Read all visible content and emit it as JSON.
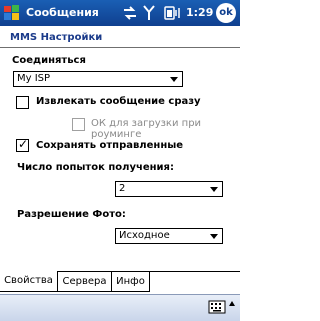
{
  "titlebar": {
    "title": "Сообщения",
    "time": "1:29",
    "ok_label": "ok",
    "icons": [
      "windows-start-icon",
      "connectivity-icon",
      "signal-icon",
      "battery-icon"
    ]
  },
  "header": {
    "title": "MMS Настройки"
  },
  "form": {
    "connect_label": "Соединяться",
    "connect_value": "My ISP",
    "retrieve_immediately": {
      "label": "Извлекать сообщение сразу",
      "checked": false
    },
    "ok_roaming": {
      "label": "ОК для загрузки при роуминге",
      "checked": false,
      "disabled": true
    },
    "save_sent": {
      "label": "Сохранять отправленные",
      "checked": true
    },
    "retries_label": "Число попыток получения:",
    "retries_value": "2",
    "photo_label": "Разрешение Фото:",
    "photo_value": "Исходное"
  },
  "tabs": [
    {
      "label": "Свойства",
      "active": true
    },
    {
      "label": "Сервера",
      "active": false
    },
    {
      "label": "Инфо",
      "active": false
    }
  ],
  "colors": {
    "titlebar": "#1a5fb4",
    "header_text": "#1a3a8a"
  }
}
